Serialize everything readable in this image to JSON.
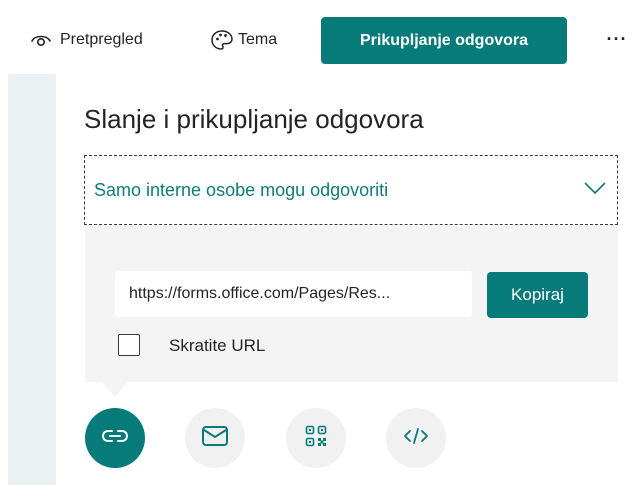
{
  "toolbar": {
    "preview_label": "Pretpregled",
    "theme_label": "Tema",
    "collect_label": "Prikupljanje odgovora",
    "more_label": "···"
  },
  "panel": {
    "title": "Slanje i prikupljanje odgovora",
    "audience_dropdown": {
      "selected": "Samo interne osobe mogu odgovoriti"
    },
    "link": {
      "url": "https://forms.office.com/Pages/Res...",
      "copy_label": "Kopiraj",
      "shorten_label": "Skratite URL",
      "shorten_checked": false
    },
    "share_options": [
      {
        "icon": "link-icon",
        "active": true
      },
      {
        "icon": "mail-icon",
        "active": false
      },
      {
        "icon": "qr-code-icon",
        "active": false
      },
      {
        "icon": "embed-code-icon",
        "active": false
      }
    ]
  },
  "colors": {
    "accent": "#077b7a",
    "accent_text": "#0f7c7b",
    "gray_panel": "#f4f4f4",
    "left_strip": "#e9f1f3"
  }
}
